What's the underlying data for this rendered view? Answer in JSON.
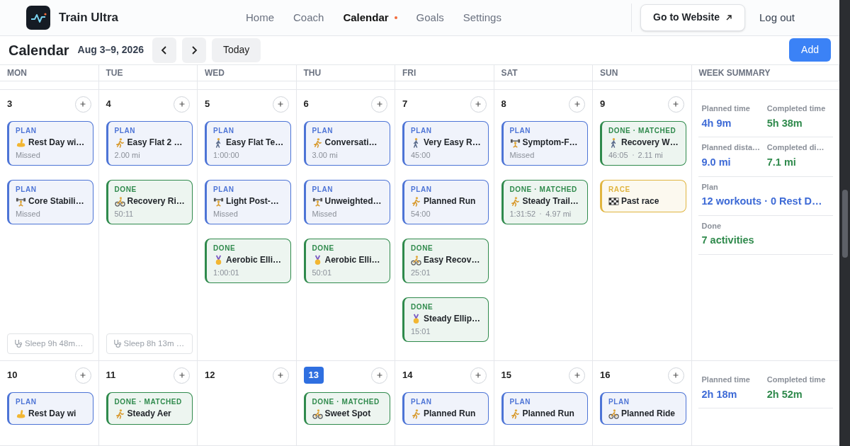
{
  "brand": {
    "name": "Train Ultra"
  },
  "nav": [
    {
      "label": "Home",
      "selected": false
    },
    {
      "label": "Coach",
      "selected": false
    },
    {
      "label": "Calendar",
      "selected": true
    },
    {
      "label": "Goals",
      "selected": false
    },
    {
      "label": "Settings",
      "selected": false
    }
  ],
  "header_actions": {
    "website": "Go to Website",
    "logout": "Log out"
  },
  "toolbar": {
    "title": "Calendar",
    "range": "Aug 3–9, 2026",
    "today": "Today",
    "add": "Add"
  },
  "columns": [
    "MON",
    "TUE",
    "WED",
    "THU",
    "FRI",
    "SAT",
    "SUN",
    "WEEK SUMMARY"
  ],
  "weeks": [
    {
      "days": [
        {
          "date": "3",
          "today": false,
          "sleep": "Sleep 9h 48m…",
          "entries": [
            {
              "color": "#4d74d6",
              "label": "PLAN",
              "kind": "rest",
              "title": "Rest Day wi…",
              "details": [
                "Missed"
              ]
            },
            {
              "color": "#4d74d6",
              "label": "PLAN",
              "kind": "strength",
              "title": "Core Stabili…",
              "details": [
                "Missed"
              ]
            }
          ]
        },
        {
          "date": "4",
          "today": false,
          "sleep": "Sleep 8h 13m …",
          "entries": [
            {
              "color": "#4d74d6",
              "label": "PLAN",
              "kind": "run",
              "title": "Easy Flat 2 …",
              "details": [
                "2.00 mi"
              ]
            },
            {
              "color": "#2f8a4c",
              "label": "DONE",
              "kind": "bike",
              "title": "Recovery Ri…",
              "details": [
                "50:11"
              ]
            }
          ]
        },
        {
          "date": "5",
          "today": false,
          "entries": [
            {
              "color": "#4d74d6",
              "label": "PLAN",
              "kind": "walk",
              "title": "Easy Flat Te…",
              "details": [
                "1:00:00"
              ]
            },
            {
              "color": "#4d74d6",
              "label": "PLAN",
              "kind": "strength",
              "title": "Light Post-…",
              "details": [
                "Missed"
              ]
            },
            {
              "color": "#2f8a4c",
              "label": "DONE",
              "kind": "elliptical",
              "title": "Aerobic Elli…",
              "details": [
                "1:00:01"
              ]
            }
          ]
        },
        {
          "date": "6",
          "today": false,
          "entries": [
            {
              "color": "#4d74d6",
              "label": "PLAN",
              "kind": "run",
              "title": "Conversati…",
              "details": [
                "3.00 mi"
              ]
            },
            {
              "color": "#4d74d6",
              "label": "PLAN",
              "kind": "strength",
              "title": "Unweighted…",
              "details": [
                "Missed"
              ]
            },
            {
              "color": "#2f8a4c",
              "label": "DONE",
              "kind": "elliptical",
              "title": "Aerobic Elli…",
              "details": [
                "50:01"
              ]
            }
          ]
        },
        {
          "date": "7",
          "today": false,
          "entries": [
            {
              "color": "#4d74d6",
              "label": "PLAN",
              "kind": "walk",
              "title": "Very Easy R…",
              "details": [
                "45:00"
              ]
            },
            {
              "color": "#4d74d6",
              "label": "PLAN",
              "kind": "run",
              "title": "Planned Run",
              "details": [
                "54:00"
              ]
            },
            {
              "color": "#2f8a4c",
              "label": "DONE",
              "kind": "bike",
              "title": "Easy Recov…",
              "details": [
                "25:01"
              ]
            },
            {
              "color": "#2f8a4c",
              "label": "DONE",
              "kind": "elliptical",
              "title": "Steady Ellip…",
              "details": [
                "15:01"
              ]
            }
          ]
        },
        {
          "date": "8",
          "today": false,
          "entries": [
            {
              "color": "#4d74d6",
              "label": "PLAN",
              "kind": "strength",
              "title": "Symptom-F…",
              "details": [
                "Missed"
              ]
            },
            {
              "color": "#2f8a4c",
              "label": "DONE · MATCHED",
              "kind": "run",
              "title": "Steady Trail…",
              "details": [
                "1:31:52",
                "4.97 mi"
              ]
            }
          ]
        },
        {
          "date": "9",
          "today": false,
          "entries": [
            {
              "color": "#2f8a4c",
              "label": "DONE · MATCHED",
              "kind": "walk",
              "title": "Recovery W…",
              "details": [
                "46:05",
                "2.11 mi"
              ]
            },
            {
              "color": "#e0b540",
              "label": "RACE",
              "kind": "race",
              "title": "Past race"
            }
          ]
        }
      ],
      "summary": [
        {
          "kind": "pair",
          "items": [
            {
              "label": "Planned time",
              "value": "4h 9m",
              "color": "#3d6ad6"
            },
            {
              "label": "Completed time",
              "value": "5h 38m",
              "color": "#2f8a4c"
            }
          ]
        },
        {
          "kind": "pair",
          "items": [
            {
              "label": "Planned dista…",
              "value": "9.0 mi",
              "color": "#3d6ad6"
            },
            {
              "label": "Completed di…",
              "value": "7.1 mi",
              "color": "#2f8a4c"
            }
          ]
        },
        {
          "kind": "single",
          "items": [
            {
              "label": "Plan",
              "value": "12 workouts · 0 Rest D…",
              "color": "#3d6ad6"
            }
          ]
        },
        {
          "kind": "single",
          "items": [
            {
              "label": "Done",
              "value": "7 activities",
              "color": "#2f8a4c"
            }
          ]
        }
      ]
    },
    {
      "days": [
        {
          "date": "10",
          "today": false,
          "entries": [
            {
              "color": "#4d74d6",
              "label": "PLAN",
              "kind": "rest",
              "title": "Rest Day wi"
            }
          ]
        },
        {
          "date": "11",
          "today": false,
          "entries": [
            {
              "color": "#2f8a4c",
              "label": "DONE · MATCHED",
              "kind": "run",
              "title": "Steady Aer"
            }
          ]
        },
        {
          "date": "12",
          "today": false
        },
        {
          "date": "13",
          "today": true,
          "entries": [
            {
              "color": "#2f8a4c",
              "label": "DONE · MATCHED",
              "kind": "bike",
              "title": "Sweet Spot"
            }
          ]
        },
        {
          "date": "14",
          "today": false,
          "entries": [
            {
              "color": "#4d74d6",
              "label": "PLAN",
              "kind": "run",
              "title": "Planned Run"
            }
          ]
        },
        {
          "date": "15",
          "today": false,
          "entries": [
            {
              "color": "#4d74d6",
              "label": "PLAN",
              "kind": "run",
              "title": "Planned Run"
            }
          ]
        },
        {
          "date": "16",
          "today": false,
          "entries": [
            {
              "color": "#4d74d6",
              "label": "PLAN",
              "kind": "bike",
              "title": "Planned Ride"
            }
          ]
        }
      ],
      "summary": [
        {
          "kind": "pair",
          "items": [
            {
              "label": "Planned time",
              "value": "2h 18m",
              "color": "#3d6ad6"
            },
            {
              "label": "Completed time",
              "value": "2h 52m",
              "color": "#2f8a4c"
            }
          ]
        }
      ]
    }
  ]
}
